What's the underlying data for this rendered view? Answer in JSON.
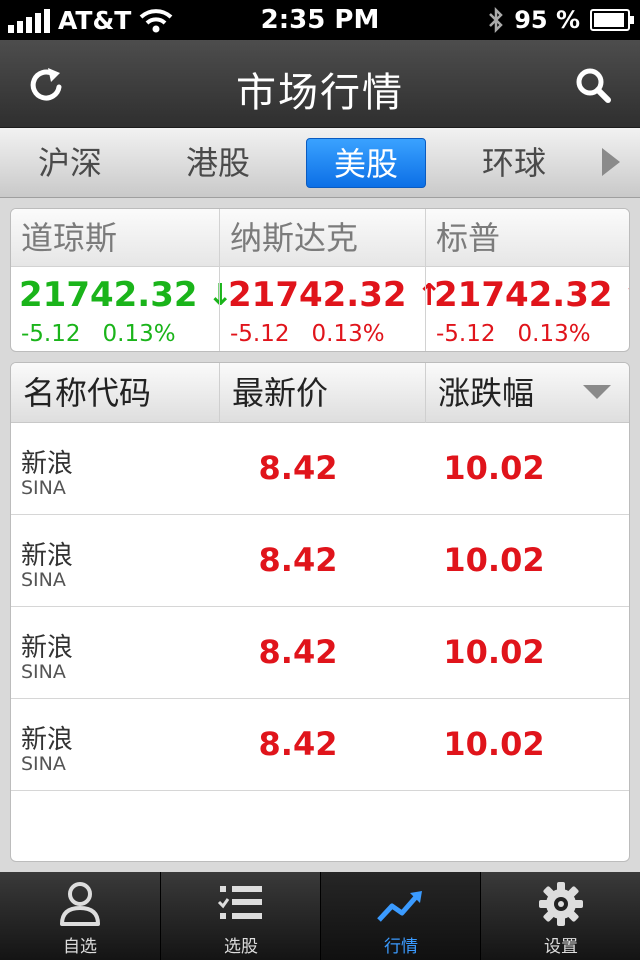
{
  "status_bar": {
    "carrier": "AT&T",
    "time": "2:35 PM",
    "battery_pct": "95 %",
    "battery_level": 0.95
  },
  "nav": {
    "title": "市场行情",
    "refresh_icon": "refresh-icon",
    "search_icon": "search-icon"
  },
  "tabs": [
    {
      "label": "沪深",
      "active": false
    },
    {
      "label": "港股",
      "active": false
    },
    {
      "label": "美股",
      "active": true
    },
    {
      "label": "环球",
      "active": false
    }
  ],
  "indices": [
    {
      "name": "道琼斯",
      "value": "21742.32",
      "direction": "down",
      "arrow": "↓",
      "change": "-5.12",
      "percent": "0.13%",
      "color": "#1ab41a"
    },
    {
      "name": "纳斯达克",
      "value": "21742.32",
      "direction": "up",
      "arrow": "↑",
      "change": "-5.12",
      "percent": "0.13%",
      "color": "#e0141b"
    },
    {
      "name": "标普",
      "value": "21742.32",
      "direction": "up",
      "arrow": "↑",
      "change": "-5.12",
      "percent": "0.13%",
      "color": "#e0141b"
    }
  ],
  "list": {
    "headers": [
      "名称代码",
      "最新价",
      "涨跌幅"
    ],
    "rows": [
      {
        "name": "新浪",
        "code": "SINA",
        "price": "8.42",
        "change": "10.02"
      },
      {
        "name": "新浪",
        "code": "SINA",
        "price": "8.42",
        "change": "10.02"
      },
      {
        "name": "新浪",
        "code": "SINA",
        "price": "8.42",
        "change": "10.02"
      },
      {
        "name": "新浪",
        "code": "SINA",
        "price": "8.42",
        "change": "10.02"
      }
    ]
  },
  "tab_bar": [
    {
      "label": "自选",
      "icon": "person-icon",
      "active": false
    },
    {
      "label": "选股",
      "icon": "checklist-icon",
      "active": false
    },
    {
      "label": "行情",
      "icon": "trend-chart-icon",
      "active": true
    },
    {
      "label": "设置",
      "icon": "gear-icon",
      "active": false
    }
  ],
  "colors": {
    "up": "#e0141b",
    "down": "#1ab41a",
    "accent": "#3b9bff"
  }
}
